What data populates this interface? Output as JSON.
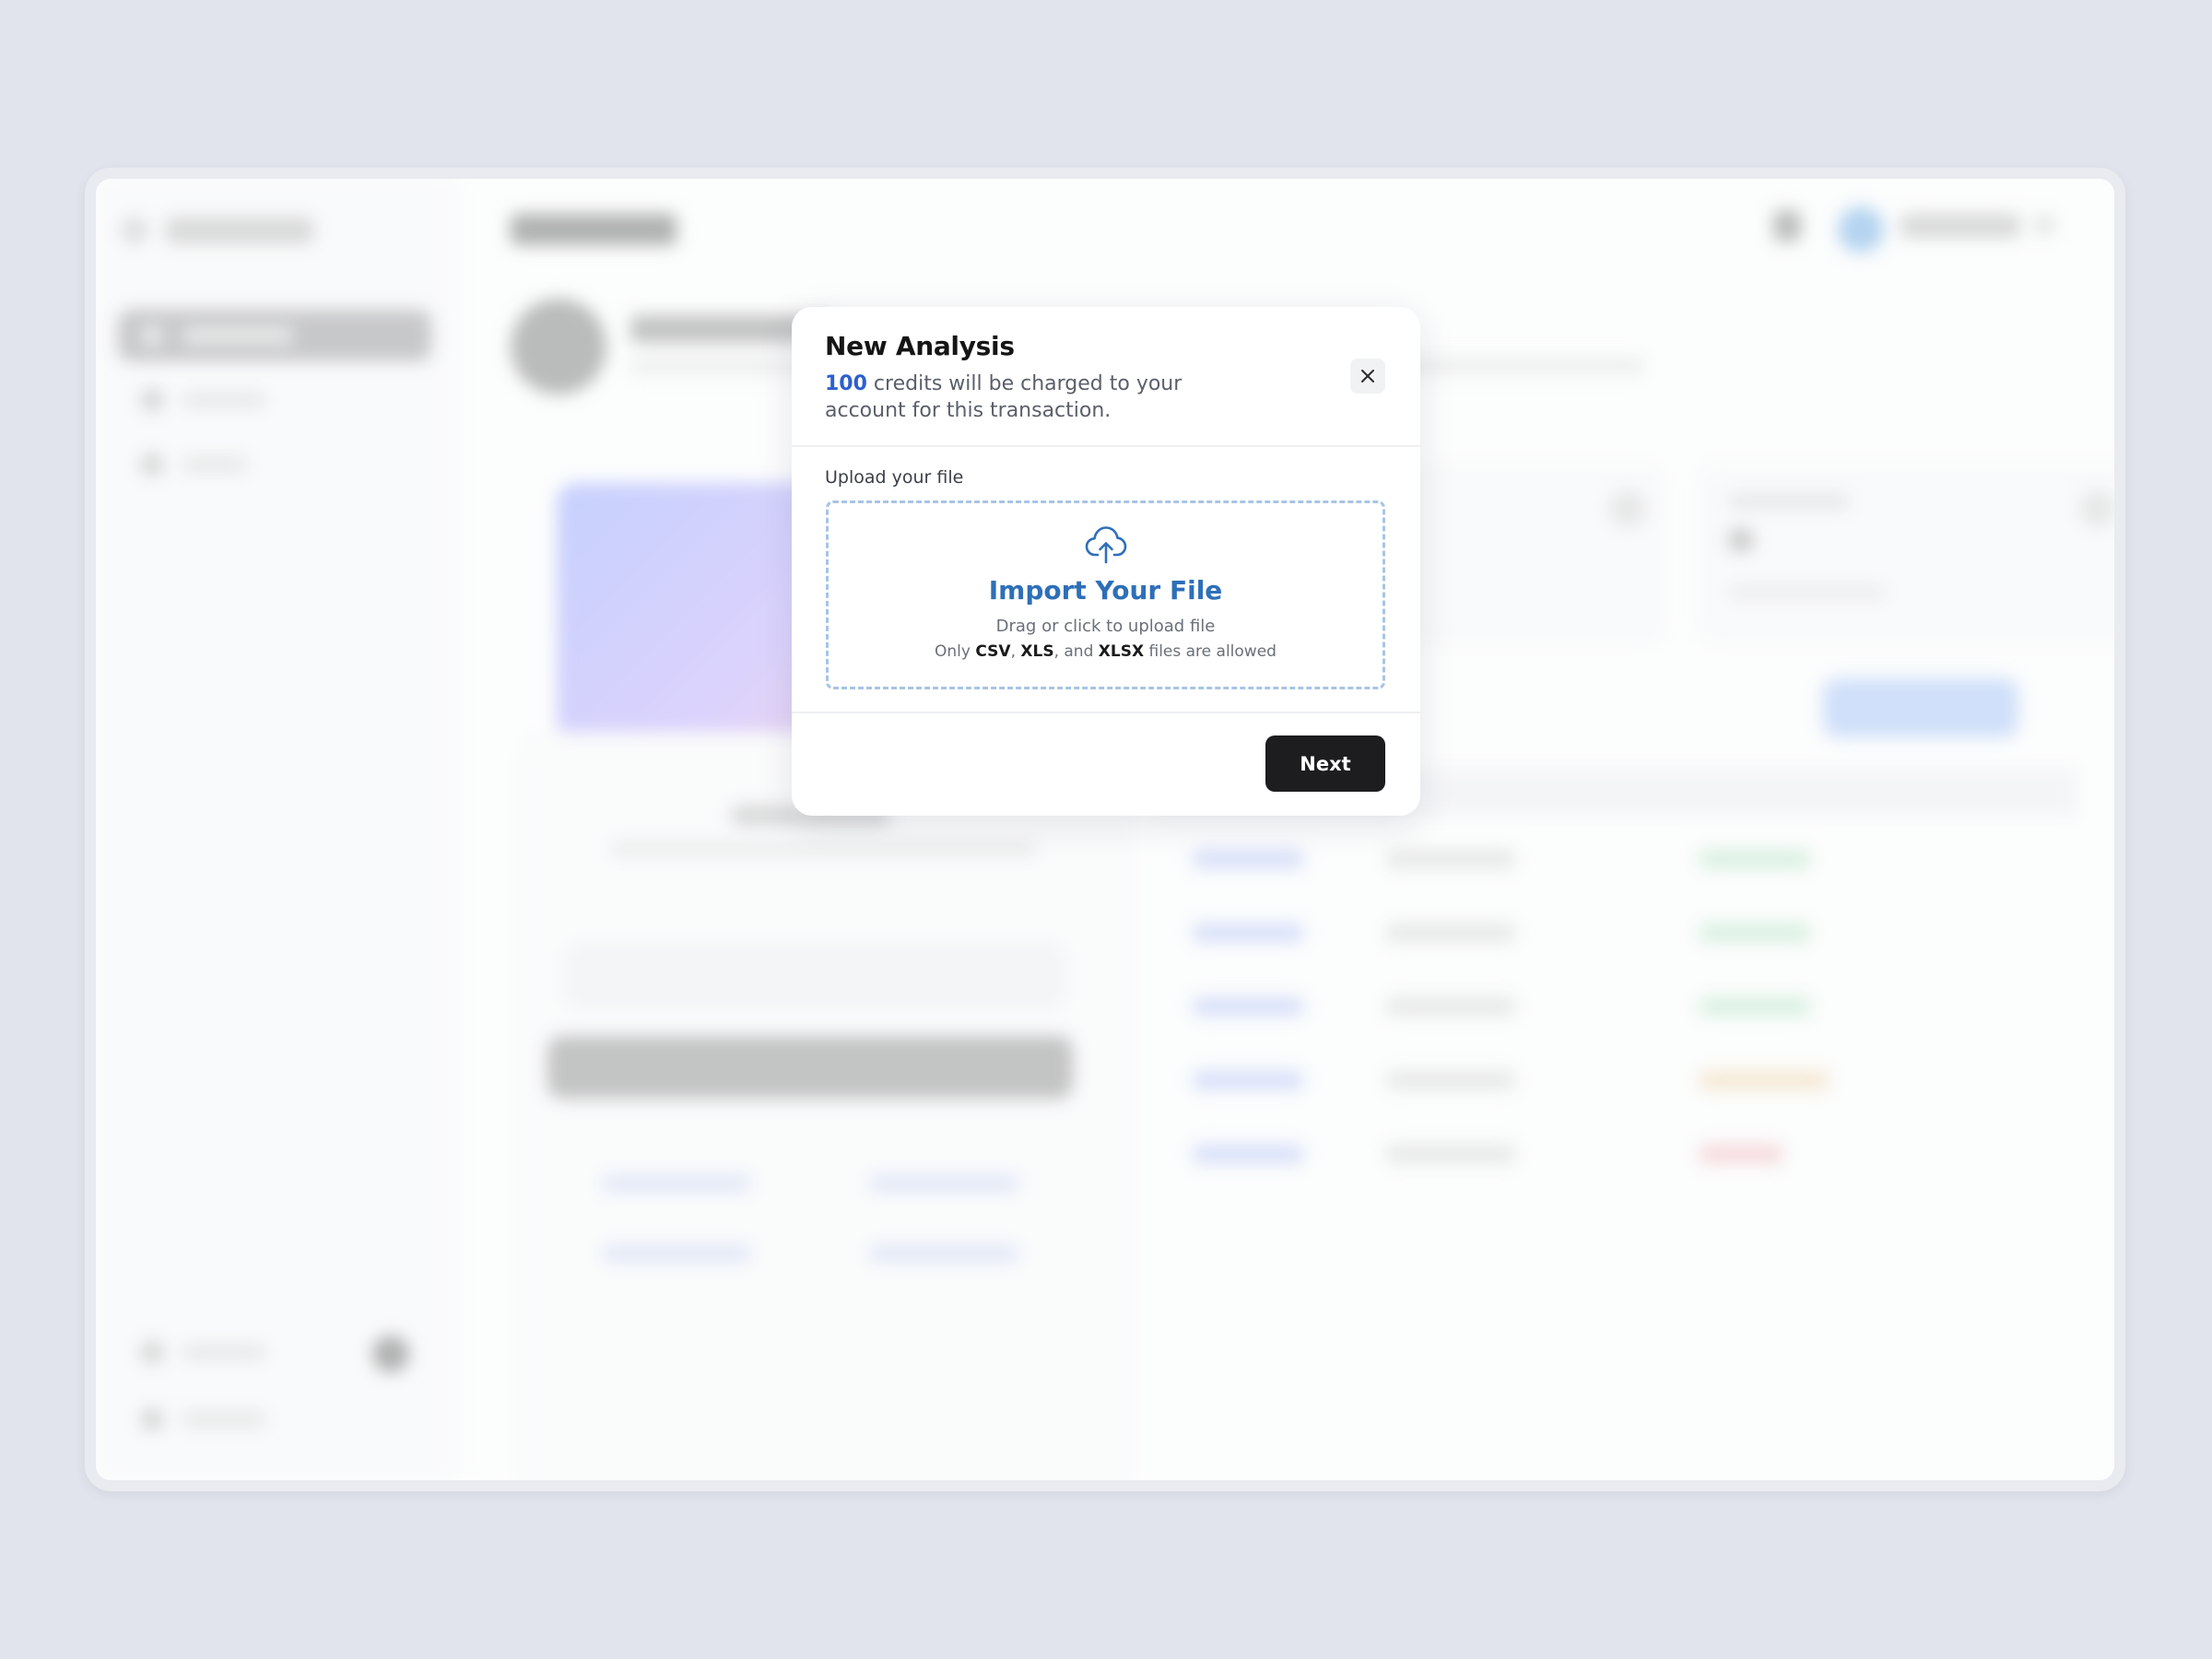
{
  "modal": {
    "title": "New Analysis",
    "credits": "100",
    "subtitle_rest": " credits will be charged to your account for this transaction.",
    "upload_label": "Upload your file",
    "dropzone": {
      "title": "Import Your File",
      "instruction": "Drag or click to upload file",
      "allowed_prefix": "Only ",
      "format_1": "CSV",
      "sep_1": ", ",
      "format_2": "XLS",
      "sep_2": ", and ",
      "format_3": "XLSX",
      "allowed_suffix": " files are allowed"
    },
    "next_label": "Next"
  },
  "icons": {
    "close": "close-icon",
    "upload": "cloud-upload-icon"
  },
  "colors": {
    "accent_blue": "#2e6fb8",
    "credits_blue": "#2d5fd0",
    "dropzone_border": "#a8c4e6",
    "next_button": "#1d1d1f",
    "page_background": "#e1e4ec"
  }
}
